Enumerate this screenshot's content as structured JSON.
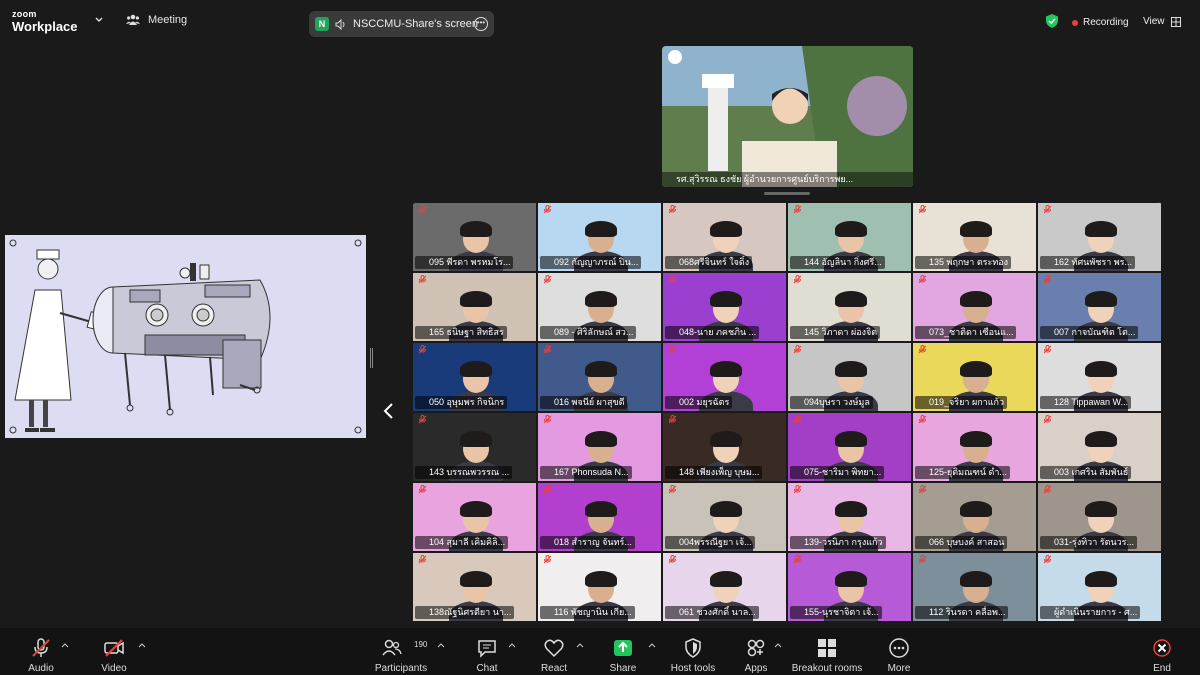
{
  "app": {
    "logo_line1": "zoom",
    "logo_line2": "Workplace",
    "meeting_label": "Meeting"
  },
  "share_pill": {
    "badge": "N",
    "text": "NSCCMU-Share's screen"
  },
  "status": {
    "recording": "Recording",
    "view": "View"
  },
  "speaker": {
    "name": "รศ.สุวิรรณ ธงชัย ผู้อำนวยการศูนย์บริการพย..."
  },
  "participants": [
    "095 พีรดา พรหมโร...",
    "092 กัญญาภรณ์ ปิน...",
    "068ศรีจินทร์ ใจดิ๋ง",
    "144 อัญลินา กิ่งศรี...",
    "135 พฤกษา ตระทอง",
    "162 ทัศนพัชรา พร...",
    "165 ธนิษฐา สิทธิสร",
    "089 - ศิริลักษณ์ สว...",
    "048-นาย ภคชภิน ...",
    "145 วิภาดา ผ่องจิต",
    "073_ชาติดา เซือนแ...",
    "007 กาจบัณฑิต โต...",
    "050 อุษุมพร กิจนิกร",
    "016 พจนีย์ ผาสุขดี",
    "002 มยุรฉัตร",
    "094บุษรา วงษ์มูล",
    "019_จริยา ผกาแก้ว",
    "128 Tippawan W...",
    "143 บรรณพวรรณ ...",
    "167 Phonsuda N...",
    "148 เพียงเพ็ญ บุษม...",
    "075-ชาริมา พิทยา...",
    "125-ยุติมณฑน์ ดำ...",
    "003 เกศริน สัมพันธ์",
    "104 สุมาลี เคิมคิลิ...",
    "018 สำราญ จันทร์...",
    "004พรรณีฐยา เจ้...",
    "139-วรนิภา กรุงแก้ว",
    "066 บุษบงค์ สาสอน",
    "031-รุ่งทิวา รัตนวร...",
    "138ณัฐนิศรตียา นา...",
    "116 พัชญานิน เกีย...",
    "061 ชวงศักดิ์ นาล...",
    "155-นุรชาจิตา เจ้...",
    "112 รินรดา คลื่อพ...",
    "ผู้ดำเนินรายการ - ศ..."
  ],
  "toolbar": {
    "audio": "Audio",
    "video": "Video",
    "participants": "Participants",
    "participants_count": "190",
    "chat": "Chat",
    "react": "React",
    "share": "Share",
    "host_tools": "Host tools",
    "apps": "Apps",
    "breakout": "Breakout rooms",
    "more": "More",
    "end": "End"
  },
  "colors": {
    "share_green": "#22c55e",
    "end_red": "#e8403a",
    "recording_red": "#e8403a"
  }
}
